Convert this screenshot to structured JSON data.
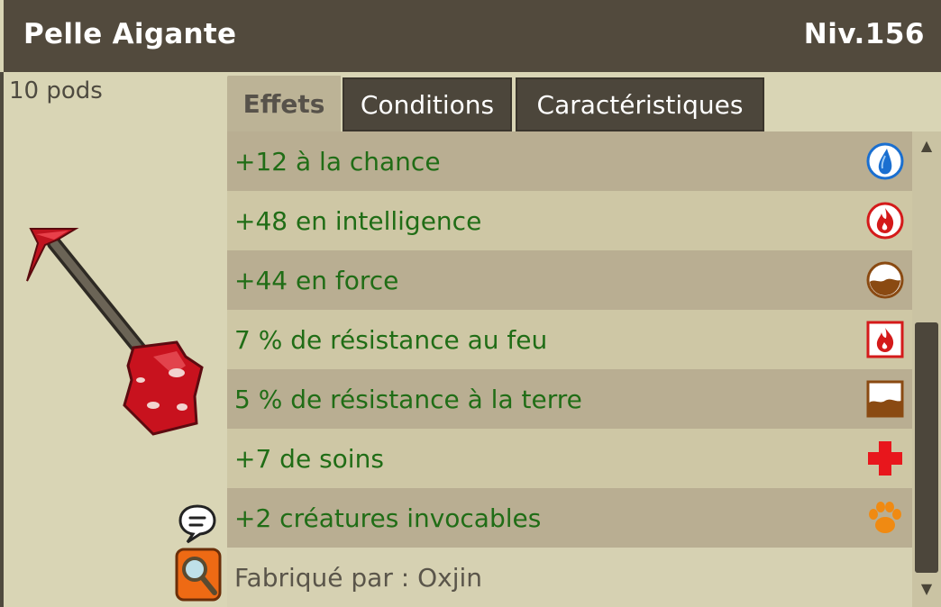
{
  "header": {
    "item_name": "Pelle Aigante",
    "level": "Niv.156"
  },
  "item": {
    "weight": "10 pods"
  },
  "tabs": [
    {
      "label": "Effets",
      "active": true
    },
    {
      "label": "Conditions",
      "active": false
    },
    {
      "label": "Caractéristiques",
      "active": false
    }
  ],
  "effects": [
    {
      "text": "+12 à la chance",
      "icon": "water-icon"
    },
    {
      "text": "+48 en intelligence",
      "icon": "fire-icon"
    },
    {
      "text": "+44 en force",
      "icon": "earth-icon"
    },
    {
      "text": "7 % de résistance au feu",
      "icon": "fire-resistance-icon"
    },
    {
      "text": "5 % de résistance à la terre",
      "icon": "earth-resistance-icon"
    },
    {
      "text": "+7 de soins",
      "icon": "heal-cross-icon"
    },
    {
      "text": "+2 créatures invocables",
      "icon": "paw-icon"
    }
  ],
  "crafted_by": "Fabriqué par : Oxjin",
  "colors": {
    "header_bg": "#524a3d",
    "effect_text": "#206d16",
    "row_dark": "#b9ae92",
    "row_light": "#cec7a5"
  }
}
